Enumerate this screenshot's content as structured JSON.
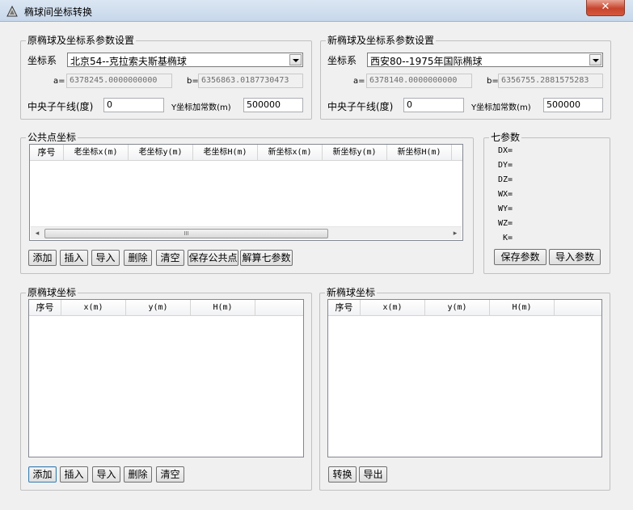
{
  "window": {
    "title": "椭球间坐标转换",
    "close_label": "✕"
  },
  "src_group": {
    "title": "原椭球及坐标系参数设置",
    "coord_label": "坐标系",
    "coord_value": "北京54--克拉索夫斯基椭球",
    "a_label": "a=",
    "a_value": "6378245.0000000000",
    "b_label": "b=",
    "b_value": "6356863.0187730473",
    "meridian_label": "中央子午线(度)",
    "meridian_value": "0",
    "yadd_label": "Y坐标加常数(m)",
    "yadd_value": "500000"
  },
  "dst_group": {
    "title": "新椭球及坐标系参数设置",
    "coord_label": "坐标系",
    "coord_value": "西安80--1975年国际椭球",
    "a_label": "a=",
    "a_value": "6378140.0000000000",
    "b_label": "b=",
    "b_value": "6356755.2881575283",
    "meridian_label": "中央子午线(度)",
    "meridian_value": "0",
    "yadd_label": "Y坐标加常数(m)",
    "yadd_value": "500000"
  },
  "common_group": {
    "title": "公共点坐标",
    "columns": [
      "序号",
      "老坐标x(m)",
      "老坐标y(m)",
      "老坐标H(m)",
      "新坐标x(m)",
      "新坐标y(m)",
      "新坐标H(m)"
    ],
    "scroll_grip": "III",
    "buttons": [
      "添加",
      "插入",
      "导入",
      "删除",
      "清空",
      "保存公共点",
      "解算七参数"
    ]
  },
  "seven_group": {
    "title": "七参数",
    "params": [
      "DX=",
      "DY=",
      "DZ=",
      "WX=",
      "WY=",
      "WZ=",
      "K="
    ],
    "save_label": "保存参数",
    "import_label": "导入参数"
  },
  "orig_group": {
    "title": "原椭球坐标",
    "columns": [
      "序号",
      "x(m)",
      "y(m)",
      "H(m)"
    ],
    "buttons": [
      "添加",
      "插入",
      "导入",
      "删除",
      "清空"
    ]
  },
  "new_group": {
    "title": "新椭球坐标",
    "columns": [
      "序号",
      "x(m)",
      "y(m)",
      "H(m)"
    ],
    "buttons": [
      "转换",
      "导出"
    ]
  }
}
